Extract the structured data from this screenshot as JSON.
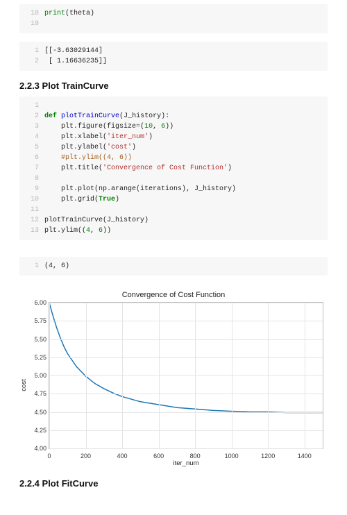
{
  "code1": {
    "start": 18,
    "lines": [
      [
        [
          "builtin",
          "print"
        ],
        [
          "plain",
          "("
        ],
        [
          "plain",
          "theta"
        ],
        [
          "plain",
          ")"
        ]
      ],
      []
    ]
  },
  "out1": {
    "start": 1,
    "lines": [
      [
        [
          "plain",
          "[[-3.63029144]"
        ]
      ],
      [
        [
          "plain",
          " [ 1.16636235]]"
        ]
      ]
    ]
  },
  "heading1": "2.2.3 Plot TrainCurve",
  "code2": {
    "start": 1,
    "lines": [
      [],
      [
        [
          "kw",
          "def"
        ],
        [
          "plain",
          " "
        ],
        [
          "fn",
          "plotTrainCurve"
        ],
        [
          "plain",
          "("
        ],
        [
          "plain",
          "J_history"
        ],
        [
          "plain",
          "):"
        ]
      ],
      [
        [
          "plain",
          "    plt.figure(figsize"
        ],
        [
          "op",
          "="
        ],
        [
          "plain",
          "("
        ],
        [
          "num",
          "10"
        ],
        [
          "plain",
          ", "
        ],
        [
          "num",
          "6"
        ],
        [
          "plain",
          "))"
        ]
      ],
      [
        [
          "plain",
          "    plt.xlabel("
        ],
        [
          "str",
          "'iter_num'"
        ],
        [
          "plain",
          ")"
        ]
      ],
      [
        [
          "plain",
          "    plt.ylabel("
        ],
        [
          "str",
          "'cost'"
        ],
        [
          "plain",
          ")"
        ]
      ],
      [
        [
          "plain",
          "    "
        ],
        [
          "warn",
          "#plt.ylim((4, 6))"
        ]
      ],
      [
        [
          "plain",
          "    plt.title("
        ],
        [
          "str",
          "'Convergence of Cost Function'"
        ],
        [
          "plain",
          ")"
        ]
      ],
      [],
      [
        [
          "plain",
          "    plt.plot(np.arange(iterations), J_history)"
        ]
      ],
      [
        [
          "plain",
          "    plt.grid("
        ],
        [
          "bool",
          "True"
        ],
        [
          "plain",
          ")"
        ]
      ],
      [],
      [
        [
          "plain",
          "plotTrainCurve(J_history)"
        ]
      ],
      [
        [
          "plain",
          "plt.ylim(("
        ],
        [
          "num",
          "4"
        ],
        [
          "plain",
          ", "
        ],
        [
          "num",
          "6"
        ],
        [
          "plain",
          "))"
        ]
      ]
    ]
  },
  "out2": {
    "start": 1,
    "lines": [
      [
        [
          "plain",
          "(4, 6)"
        ]
      ]
    ]
  },
  "heading2": "2.2.4 Plot FitCurve",
  "chart_data": {
    "type": "line",
    "title": "Convergence of Cost Function",
    "xlabel": "iter_num",
    "ylabel": "cost",
    "xlim": [
      0,
      1500
    ],
    "ylim": [
      4.0,
      6.0
    ],
    "xticks": [
      0,
      200,
      400,
      600,
      800,
      1000,
      1200,
      1400
    ],
    "yticks": [
      4.0,
      4.25,
      4.5,
      4.75,
      5.0,
      5.25,
      5.5,
      5.75,
      6.0
    ],
    "series": [
      {
        "name": "cost",
        "x": [
          0,
          20,
          40,
          60,
          80,
          100,
          150,
          200,
          250,
          300,
          350,
          400,
          500,
          600,
          700,
          800,
          900,
          1000,
          1100,
          1200,
          1300,
          1400,
          1500
        ],
        "values": [
          6.0,
          5.82,
          5.66,
          5.52,
          5.4,
          5.3,
          5.12,
          4.99,
          4.89,
          4.82,
          4.76,
          4.71,
          4.64,
          4.6,
          4.56,
          4.54,
          4.52,
          4.51,
          4.5,
          4.5,
          4.49,
          4.49,
          4.49
        ]
      }
    ]
  }
}
